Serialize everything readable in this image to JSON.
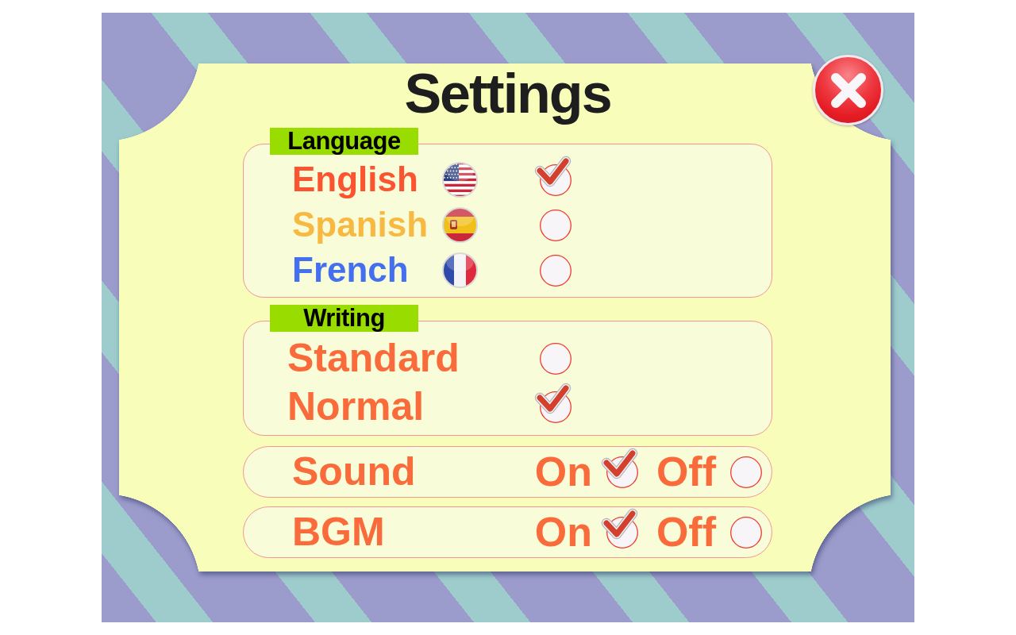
{
  "title": "Settings",
  "language": {
    "label": "Language",
    "options": [
      {
        "label": "English",
        "color": "#fa5430",
        "selected": true
      },
      {
        "label": "Spanish",
        "color": "#f7b942",
        "selected": false
      },
      {
        "label": "French",
        "color": "#4470f0",
        "selected": false
      }
    ]
  },
  "writing": {
    "label": "Writing",
    "options": [
      {
        "label": "Standard",
        "selected": false
      },
      {
        "label": "Normal",
        "selected": true
      }
    ]
  },
  "toggles": [
    {
      "label": "Sound",
      "options": [
        {
          "label": "On",
          "selected": true
        },
        {
          "label": "Off",
          "selected": false
        }
      ]
    },
    {
      "label": "BGM",
      "options": [
        {
          "label": "On",
          "selected": true
        },
        {
          "label": "Off",
          "selected": false
        }
      ]
    }
  ]
}
